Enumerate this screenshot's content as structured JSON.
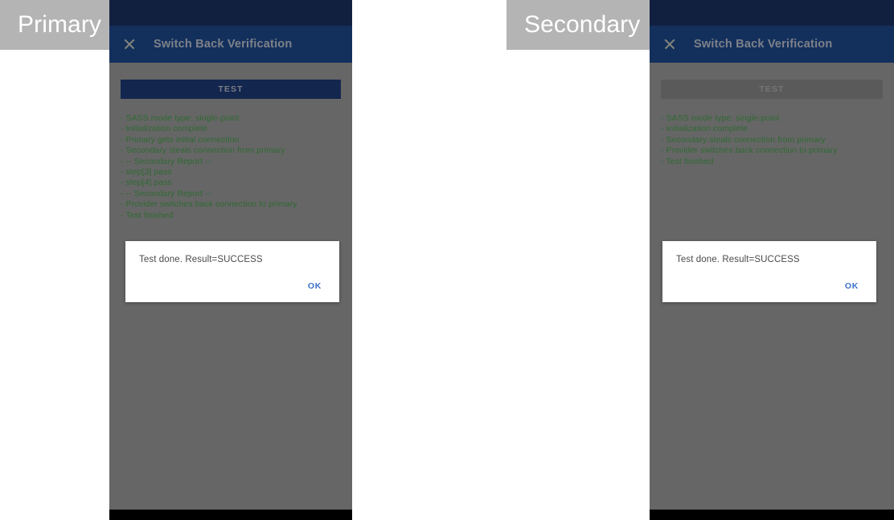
{
  "captions": {
    "primary": "Primary",
    "secondary": "Secondary"
  },
  "colors": {
    "status_bar": "#122040",
    "app_bar": "#13305d",
    "panel_background": "#666666",
    "button_enabled": "#13264e",
    "button_disabled": "#5a5a5a",
    "log_text": "#2f6a32",
    "dialog_accent": "#3b6fc7",
    "caption_chip": "#b4b4b4",
    "nav_bar": "#000000"
  },
  "primary": {
    "app_bar": {
      "close_icon": "close-icon",
      "title": "Switch Back Verification"
    },
    "test_button": {
      "label": "TEST",
      "state": "enabled"
    },
    "log_lines": [
      "- SASS mode type: single-point",
      "- Initialization complete",
      "- Primary gets initial connection",
      "- Secondary steals connection from primary",
      "- -- Secondary Report --",
      "- step[3] pass",
      "- step[4] pass",
      "- -- Secondary Report --",
      "- Provider switches back connection to primary",
      "- Test finished"
    ],
    "dialog": {
      "message": "Test done. Result=SUCCESS",
      "ok_label": "OK"
    }
  },
  "secondary": {
    "app_bar": {
      "close_icon": "close-icon",
      "title": "Switch Back Verification"
    },
    "test_button": {
      "label": "TEST",
      "state": "disabled"
    },
    "log_lines": [
      "- SASS mode type: single-point",
      "- Initialization complete",
      "- Secondary steals connection from primary",
      "- Provider switches back connection to primary",
      "- Test finished"
    ],
    "dialog": {
      "message": "Test done. Result=SUCCESS",
      "ok_label": "OK"
    }
  }
}
